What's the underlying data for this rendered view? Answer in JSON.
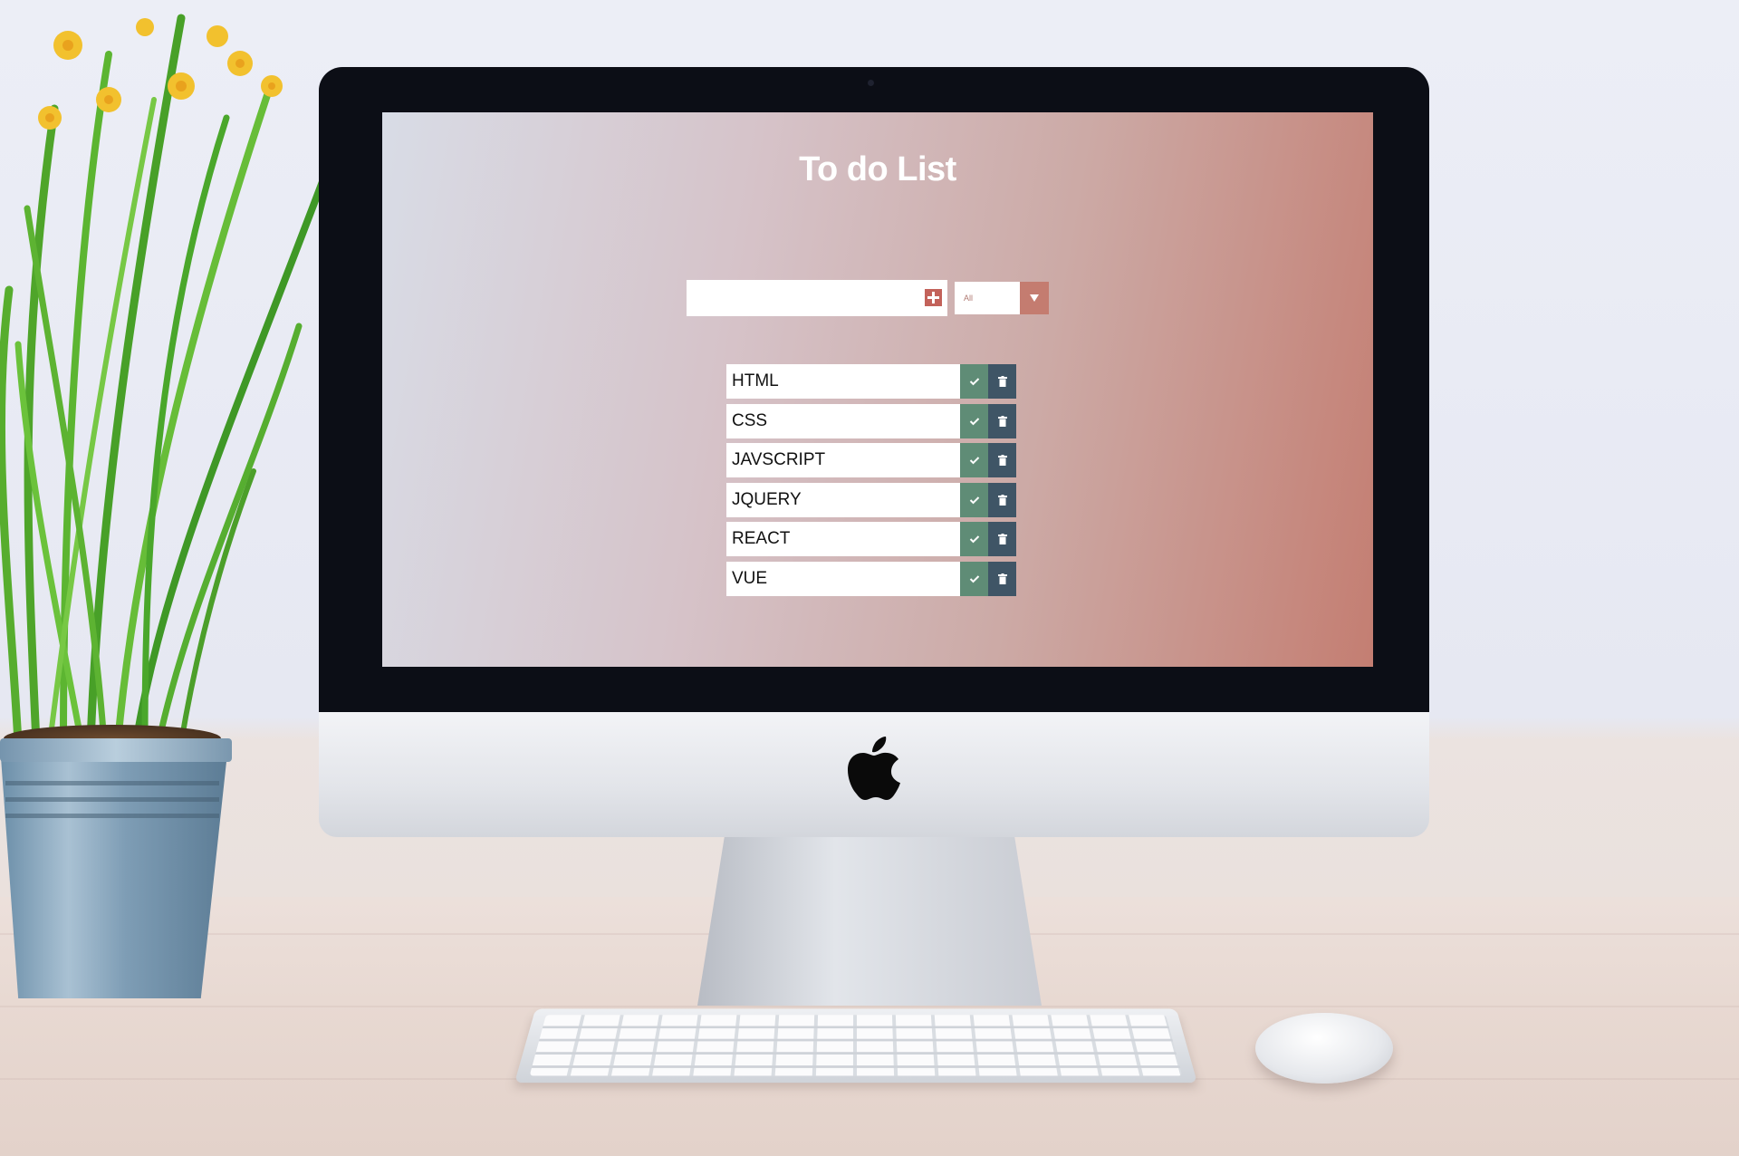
{
  "app": {
    "title": "To do List"
  },
  "new_todo": {
    "value": "",
    "placeholder": "",
    "add_icon": "plus-square-icon"
  },
  "filter": {
    "selected": "All",
    "arrow_icon": "caret-down-icon"
  },
  "todos": [
    {
      "text": "HTML",
      "complete_icon": "check-icon",
      "delete_icon": "trash-icon"
    },
    {
      "text": "CSS",
      "complete_icon": "check-icon",
      "delete_icon": "trash-icon"
    },
    {
      "text": "JAVSCRIPT",
      "complete_icon": "check-icon",
      "delete_icon": "trash-icon"
    },
    {
      "text": "JQUERY",
      "complete_icon": "check-icon",
      "delete_icon": "trash-icon"
    },
    {
      "text": "REACT",
      "complete_icon": "check-icon",
      "delete_icon": "trash-icon"
    },
    {
      "text": "VUE",
      "complete_icon": "check-icon",
      "delete_icon": "trash-icon"
    }
  ],
  "colors": {
    "add_button": "#c3625a",
    "filter_arrow": "#c47c70",
    "complete_button": "#5f8c76",
    "delete_button": "#3f5566",
    "title_text": "#ffffff"
  }
}
